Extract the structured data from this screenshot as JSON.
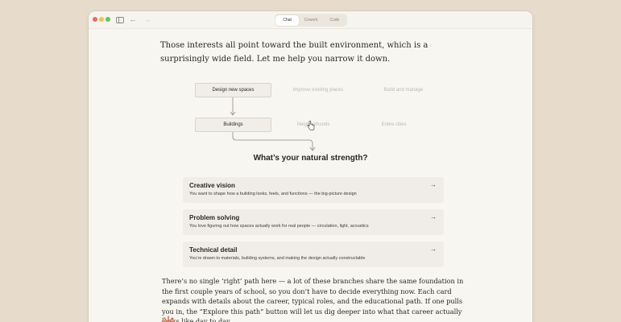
{
  "titlebar": {
    "tabs": [
      {
        "label": "Chat",
        "active": true
      },
      {
        "label": "Cowork",
        "active": false
      },
      {
        "label": "Code",
        "active": false
      }
    ],
    "icons": [
      "sidebar-toggle-icon",
      "back-arrow-icon",
      "forward-arrow-icon"
    ]
  },
  "message": {
    "intro": "Those interests all point toward the built environment, which is a surprisingly wide field. Let me help you narrow it down.",
    "flow": {
      "row1": [
        "Design new spaces",
        "Improve existing places",
        "Build and manage"
      ],
      "row2": [
        "Buildings",
        "Neighborhoods",
        "Entire cities"
      ]
    },
    "question": "What’s your natural strength?",
    "cards": [
      {
        "title": "Creative vision",
        "desc": "You want to shape how a building looks, feels, and functions — the big-picture design",
        "arrow": "→"
      },
      {
        "title": "Problem solving",
        "desc": "You love figuring out how spaces actually work for real people — circulation, light, acoustics",
        "arrow": "→"
      },
      {
        "title": "Technical detail",
        "desc": "You’re drawn to materials, building systems, and making the design actually constructable",
        "arrow": "→"
      }
    ],
    "outro": "There’s no single ‘right’ path here — a lot of these branches share the same foundation in the first couple years of school, so you don’t have to decide everything now.  Each card expands with details about the career, typical roles, and the educational path. If one pulls you in, the “Explore this path” button will let us dig deeper into what that career actually looks like day to day."
  },
  "colors": {
    "background": "#e7dccb",
    "window": "#f8f6f1",
    "card": "#f0ede7",
    "accent_logo": "#d97757"
  }
}
